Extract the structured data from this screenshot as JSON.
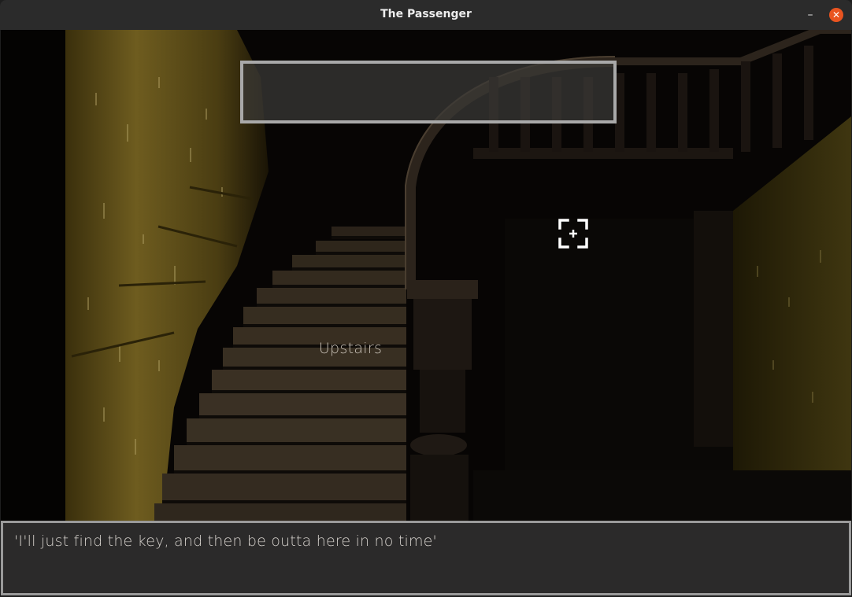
{
  "window": {
    "title": "The Passenger",
    "minimize_label": "–",
    "close_label": "✕"
  },
  "scene": {
    "hotspot_label": "Upstairs"
  },
  "dialog": {
    "text": "'I'll just find the key, and then be outta here in no time'"
  },
  "colors": {
    "accent_close": "#e95420",
    "wall": "#6b5a1e",
    "frame": "#a9a9a9"
  }
}
